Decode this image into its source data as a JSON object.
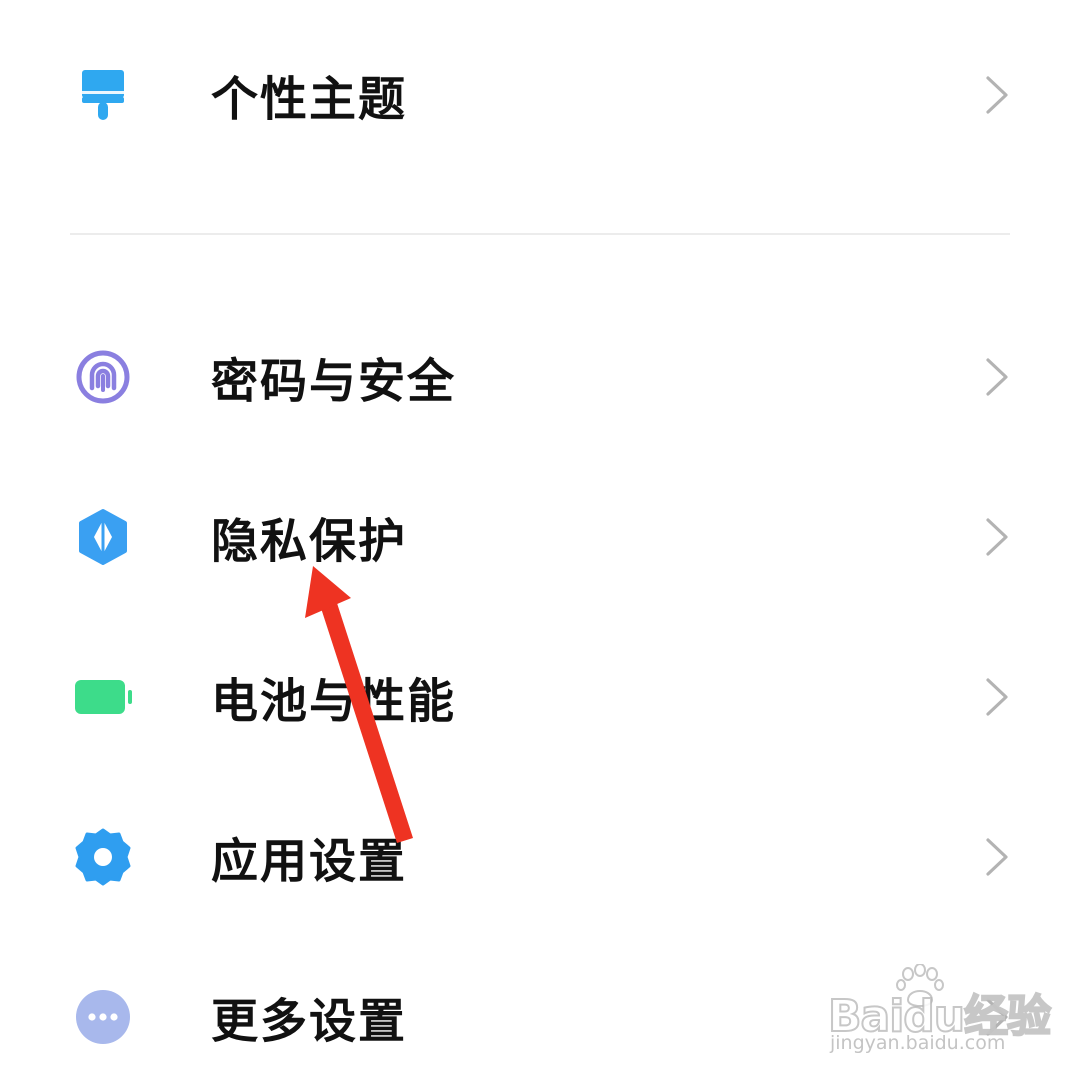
{
  "settings": {
    "items": [
      {
        "label": "个性主题",
        "icon": "paintbrush-icon",
        "color": "#2fa8f0"
      },
      {
        "label": "密码与安全",
        "icon": "fingerprint-icon",
        "color": "#8a7fe0"
      },
      {
        "label": "隐私保护",
        "icon": "privacy-shield-icon",
        "color": "#3aa0f2"
      },
      {
        "label": "电池与性能",
        "icon": "battery-icon",
        "color": "#3ddc8a"
      },
      {
        "label": "应用设置",
        "icon": "gear-icon",
        "color": "#2f9ef0"
      },
      {
        "label": "更多设置",
        "icon": "more-dots-icon",
        "color": "#a8b8ec"
      }
    ]
  },
  "annotation": {
    "arrow_color": "#ee3322"
  },
  "watermark": {
    "logo": "Baidu经验",
    "url": "jingyan.baidu.com"
  }
}
